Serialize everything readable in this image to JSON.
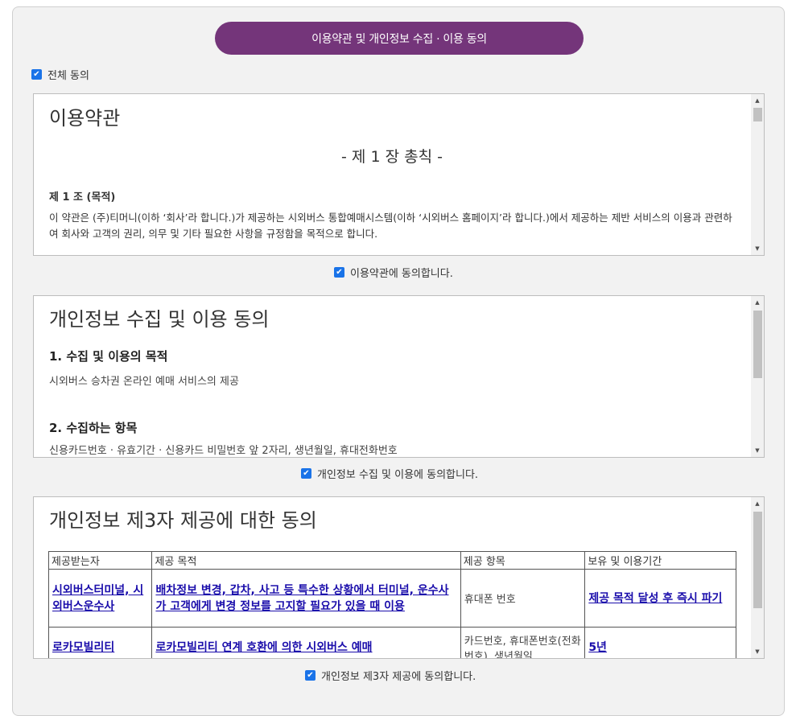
{
  "header": {
    "title": "이용약관 및 개인정보 수집 · 이용 동의"
  },
  "agree_all": {
    "label": "전체 동의",
    "checked": true
  },
  "terms": {
    "title": "이용약관",
    "chapter": "- 제 1 장 총칙 -",
    "article_title": "제 1 조 (목적)",
    "article_text": "이 약관은 (주)티머니(이하 ‘회사’라 합니다.)가 제공하는 시외버스 통합예매시스템(이하 ‘시외버스 홈페이지’라 합니다.)에서 제공하는 제반 서비스의 이용과 관련하여 회사와 고객의 권리, 의무 및 기타 필요한 사항을 규정함을 목적으로 합니다.",
    "agree_label": "이용약관에 동의합니다.",
    "agree_checked": true
  },
  "privacy": {
    "title": "개인정보 수집 및 이용 동의",
    "sec1_title": "1. 수집 및 이용의 목적",
    "sec1_text": "시외버스 승차권 온라인 예매 서비스의 제공",
    "sec2_title": "2. 수집하는 항목",
    "sec2_text": "신용카드번호 · 유효기간 · 신용카드 비밀번호 앞 2자리, 생년월일, 휴대전화번호",
    "agree_label": "개인정보 수집 및 이용에 동의합니다.",
    "agree_checked": true
  },
  "third_party": {
    "title": "개인정보 제3자 제공에 대한 동의",
    "columns": [
      "제공받는자",
      "제공 목적",
      "제공 항목",
      "보유 및 이용기간"
    ],
    "rows": [
      {
        "recipient": "시외버스터미널, 시외버스운수사",
        "purpose": "배차정보 변경, 갑차, 사고 등 특수한 상황에서 터미널, 운수사가 고객에게 변경 정보를 고지할 필요가 있을 때 이용",
        "items": "휴대폰 번호",
        "period": "제공 목적 달성 후 즉시 파기"
      },
      {
        "recipient": "로카모빌리티",
        "purpose": "로카모빌리티 연계 호환에 의한 시외버스 예매",
        "items": "카드번호, 휴대폰번호(전화번호), 생년월일",
        "period": "5년"
      }
    ],
    "agree_label": "개인정보 제3자 제공에 동의합니다.",
    "agree_checked": true
  },
  "icons": {
    "checkbox": "checkmark-icon",
    "scroll_up": "triangle-up-icon",
    "scroll_down": "triangle-down-icon"
  },
  "colors": {
    "header_bg": "#74357a",
    "checkbox": "#1a73e8",
    "link": "#1a0dab"
  }
}
